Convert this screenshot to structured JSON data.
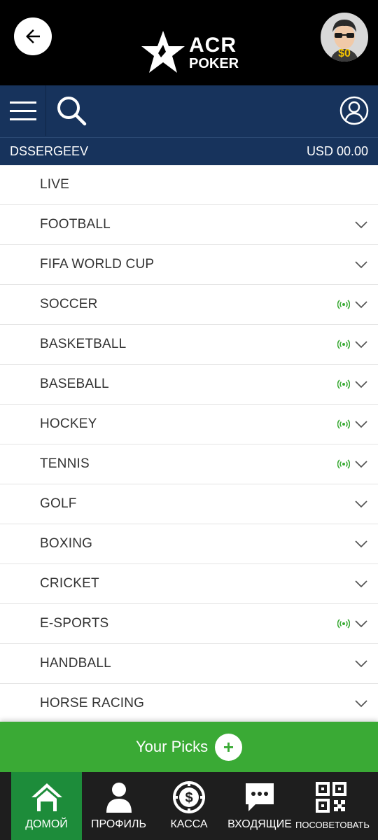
{
  "header": {
    "back_icon": "arrow-left-icon",
    "logo": {
      "line1": "ACR",
      "line2": "POKER"
    },
    "avatar": {
      "balance": "$0"
    }
  },
  "navbar": {
    "menu_icon": "hamburger-icon",
    "search_icon": "search-icon",
    "account_icon": "user-circle-icon"
  },
  "account": {
    "username": "DSSERGEEV",
    "balance": "USD 00.00"
  },
  "sports": [
    {
      "label": "LIVE",
      "live": false,
      "expandable": false
    },
    {
      "label": "FOOTBALL",
      "live": false,
      "expandable": true
    },
    {
      "label": "FIFA WORLD CUP",
      "live": false,
      "expandable": true
    },
    {
      "label": "SOCCER",
      "live": true,
      "expandable": true
    },
    {
      "label": "BASKETBALL",
      "live": true,
      "expandable": true
    },
    {
      "label": "BASEBALL",
      "live": true,
      "expandable": true
    },
    {
      "label": "HOCKEY",
      "live": true,
      "expandable": true
    },
    {
      "label": "TENNIS",
      "live": true,
      "expandable": true
    },
    {
      "label": "GOLF",
      "live": false,
      "expandable": true
    },
    {
      "label": "BOXING",
      "live": false,
      "expandable": true
    },
    {
      "label": "CRICKET",
      "live": false,
      "expandable": true
    },
    {
      "label": "E-SPORTS",
      "live": true,
      "expandable": true
    },
    {
      "label": "HANDBALL",
      "live": false,
      "expandable": true
    },
    {
      "label": "HORSE RACING",
      "live": false,
      "expandable": true
    }
  ],
  "picks": {
    "label": "Your Picks",
    "plus": "+"
  },
  "bottom_nav": [
    {
      "label": "ДОМОЙ",
      "icon": "home-icon",
      "active": true
    },
    {
      "label": "ПРОФИЛЬ",
      "icon": "person-icon",
      "active": false
    },
    {
      "label": "КАССА",
      "icon": "dollar-chip-icon",
      "active": false
    },
    {
      "label": "ВХОДЯЩИЕ",
      "icon": "chat-bubble-icon",
      "active": false
    },
    {
      "label": "ПОСОВЕТОВАТЬ",
      "icon": "qr-code-icon",
      "active": false
    }
  ],
  "colors": {
    "header_bg": "#000000",
    "nav_bg": "#17335c",
    "picks_green": "#3aaa35",
    "active_tab": "#1d8c3a",
    "live_indicator": "#3aaa35"
  }
}
